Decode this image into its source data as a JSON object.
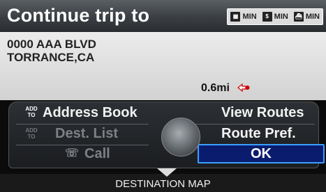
{
  "header": {
    "title": "Continue trip to",
    "pills": [
      {
        "icon": "toll-road-icon",
        "label": "MIN"
      },
      {
        "icon": "toll-dollar-icon",
        "label": "MIN"
      },
      {
        "icon": "ferry-icon",
        "label": "MIN"
      }
    ]
  },
  "address": {
    "line1": "0000 AAA BLVD",
    "line2": "TORRANCE,CA",
    "distance": "0.6mi"
  },
  "menu": {
    "address_book_prefix": "ADD TO",
    "address_book": "Address Book",
    "dest_list_prefix": "ADD TO",
    "dest_list": "Dest. List",
    "call": "Call",
    "view_routes": "View Routes",
    "route_pref": "Route Pref.",
    "ok": "OK"
  },
  "bottom": {
    "label": "DESTINATION MAP"
  },
  "colors": {
    "ok_background": "#0a1c6e",
    "ok_border": "#3aa0ff",
    "direction_marker": "#cc0000"
  }
}
